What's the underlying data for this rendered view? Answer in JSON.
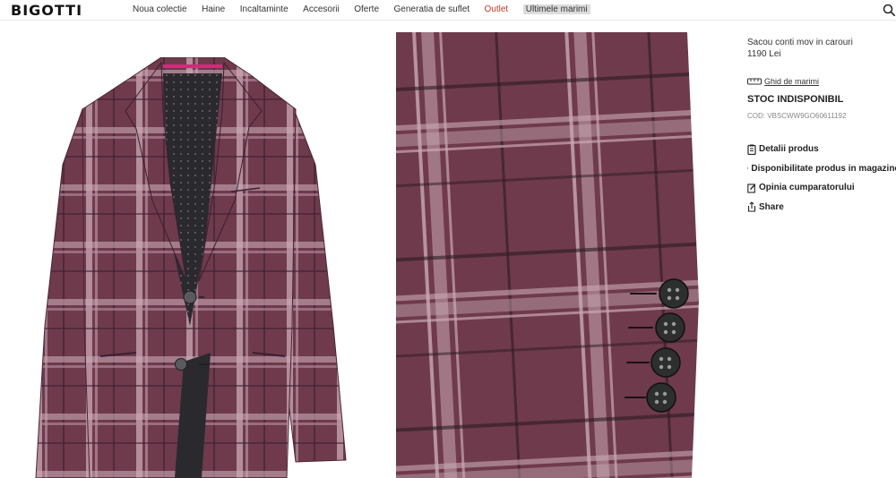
{
  "header": {
    "logo": "BIGOTTI",
    "nav": [
      {
        "label": "Noua colectie"
      },
      {
        "label": "Haine"
      },
      {
        "label": "Incaltaminte"
      },
      {
        "label": "Accesorii"
      },
      {
        "label": "Oferte"
      },
      {
        "label": "Generatia de suflet"
      },
      {
        "label": "Outlet"
      },
      {
        "label": "Ultimele marimi"
      }
    ],
    "search_icon": "search-icon"
  },
  "product": {
    "name": "Sacou conti mov in carouri",
    "price": "1190 Lei",
    "size_guide": "Ghid de marimi",
    "stock": "STOC INDISPONIBIL",
    "code": "COD: VBSCWW9GO60611192",
    "actions": [
      {
        "label": "Detalii produs",
        "icon": "clipboard-icon"
      },
      {
        "label": "Disponibilitate produs in magazine",
        "icon": "location-pin-icon"
      },
      {
        "label": "Opinia cumparatorului",
        "icon": "edit-icon"
      },
      {
        "label": "Share",
        "icon": "share-icon"
      }
    ]
  },
  "colors": {
    "fabric_base": "#6e3a4c",
    "check_light": "#c9a9b4",
    "check_dark": "#2b1a22",
    "outlet_red": "#c0392b",
    "lining_pink": "#d6287a"
  },
  "images": {
    "main": "plaid-jacket-front",
    "detail": "plaid-fabric-sleeve-buttons-closeup"
  }
}
